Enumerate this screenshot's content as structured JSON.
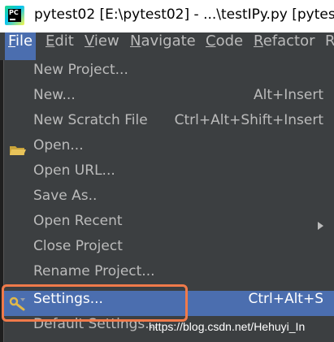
{
  "window": {
    "title": "pytest02 [E:\\pytest02] - ...\\testIPy.py [pytes",
    "logo_text": "PC"
  },
  "menubar": {
    "items": [
      {
        "label": "File",
        "underline": "F",
        "rest": "ile",
        "active": true
      },
      {
        "label": "Edit",
        "underline": "E",
        "rest": "dit"
      },
      {
        "label": "View",
        "underline": "V",
        "rest": "iew"
      },
      {
        "label": "Navigate",
        "underline": "N",
        "rest": "avigate"
      },
      {
        "label": "Code",
        "underline": "C",
        "rest": "ode"
      },
      {
        "label": "Refactor",
        "underline": "R",
        "rest": "efactor"
      },
      {
        "label": "R"
      }
    ]
  },
  "file_menu": {
    "items": [
      {
        "label": "New Project...",
        "shortcut": ""
      },
      {
        "label": "New...",
        "shortcut": "Alt+Insert"
      },
      {
        "label": "New Scratch File",
        "shortcut": "Ctrl+Alt+Shift+Insert"
      },
      {
        "label": "Open...",
        "shortcut": "",
        "icon": "folder-icon"
      },
      {
        "label": "Open URL...",
        "shortcut": ""
      },
      {
        "label": "Save As..",
        "shortcut": ""
      },
      {
        "label": "Open Recent",
        "shortcut": "",
        "submenu": true
      },
      {
        "label": "Close Project",
        "shortcut": ""
      },
      {
        "label": "Rename Project...",
        "shortcut": ""
      },
      {
        "label": "Settings...",
        "shortcut": "Ctrl+Alt+S",
        "icon": "wrench-icon",
        "selected": true
      },
      {
        "label": "Default Settings...",
        "shortcut": ""
      }
    ]
  },
  "watermark": "https://blog.csdn.net/Hehuyi_In",
  "colors": {
    "menu_bg": "#3c3f41",
    "selection": "#4b6eaf",
    "highlight_box": "#f07a4a",
    "text": "#bbbbbb"
  }
}
